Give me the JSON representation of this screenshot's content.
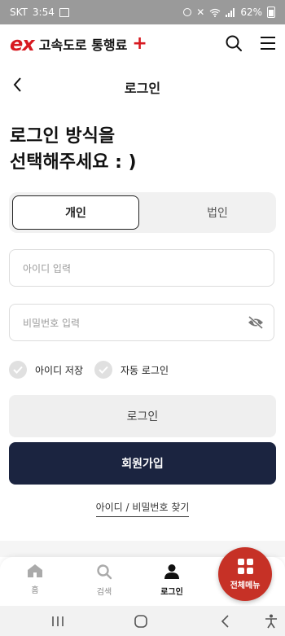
{
  "status_bar": {
    "carrier": "SKT",
    "time": "3:54",
    "battery": "62%"
  },
  "header": {
    "logo_ex": "ex",
    "logo_name": "고속도로 통행료",
    "logo_plus": "+"
  },
  "page": {
    "title": "로그인",
    "headline": "로그인 방식을\n선택해주세요 : )"
  },
  "segment": {
    "personal": "개인",
    "corporate": "법인"
  },
  "form": {
    "id_placeholder": "아이디 입력",
    "pw_placeholder": "비밀번호 입력",
    "save_id": "아이디 저장",
    "auto_login": "자동 로그인",
    "login_button": "로그인",
    "join_button": "회원가입",
    "find_link": "아이디 / 비밀번호 찾기"
  },
  "bottom_nav": {
    "home": "홈",
    "search": "검색",
    "login": "로그인",
    "all_menu": "전체메뉴"
  },
  "colors": {
    "brand_red": "#d71920",
    "navy": "#1b2440",
    "fab_red": "#c63126"
  }
}
